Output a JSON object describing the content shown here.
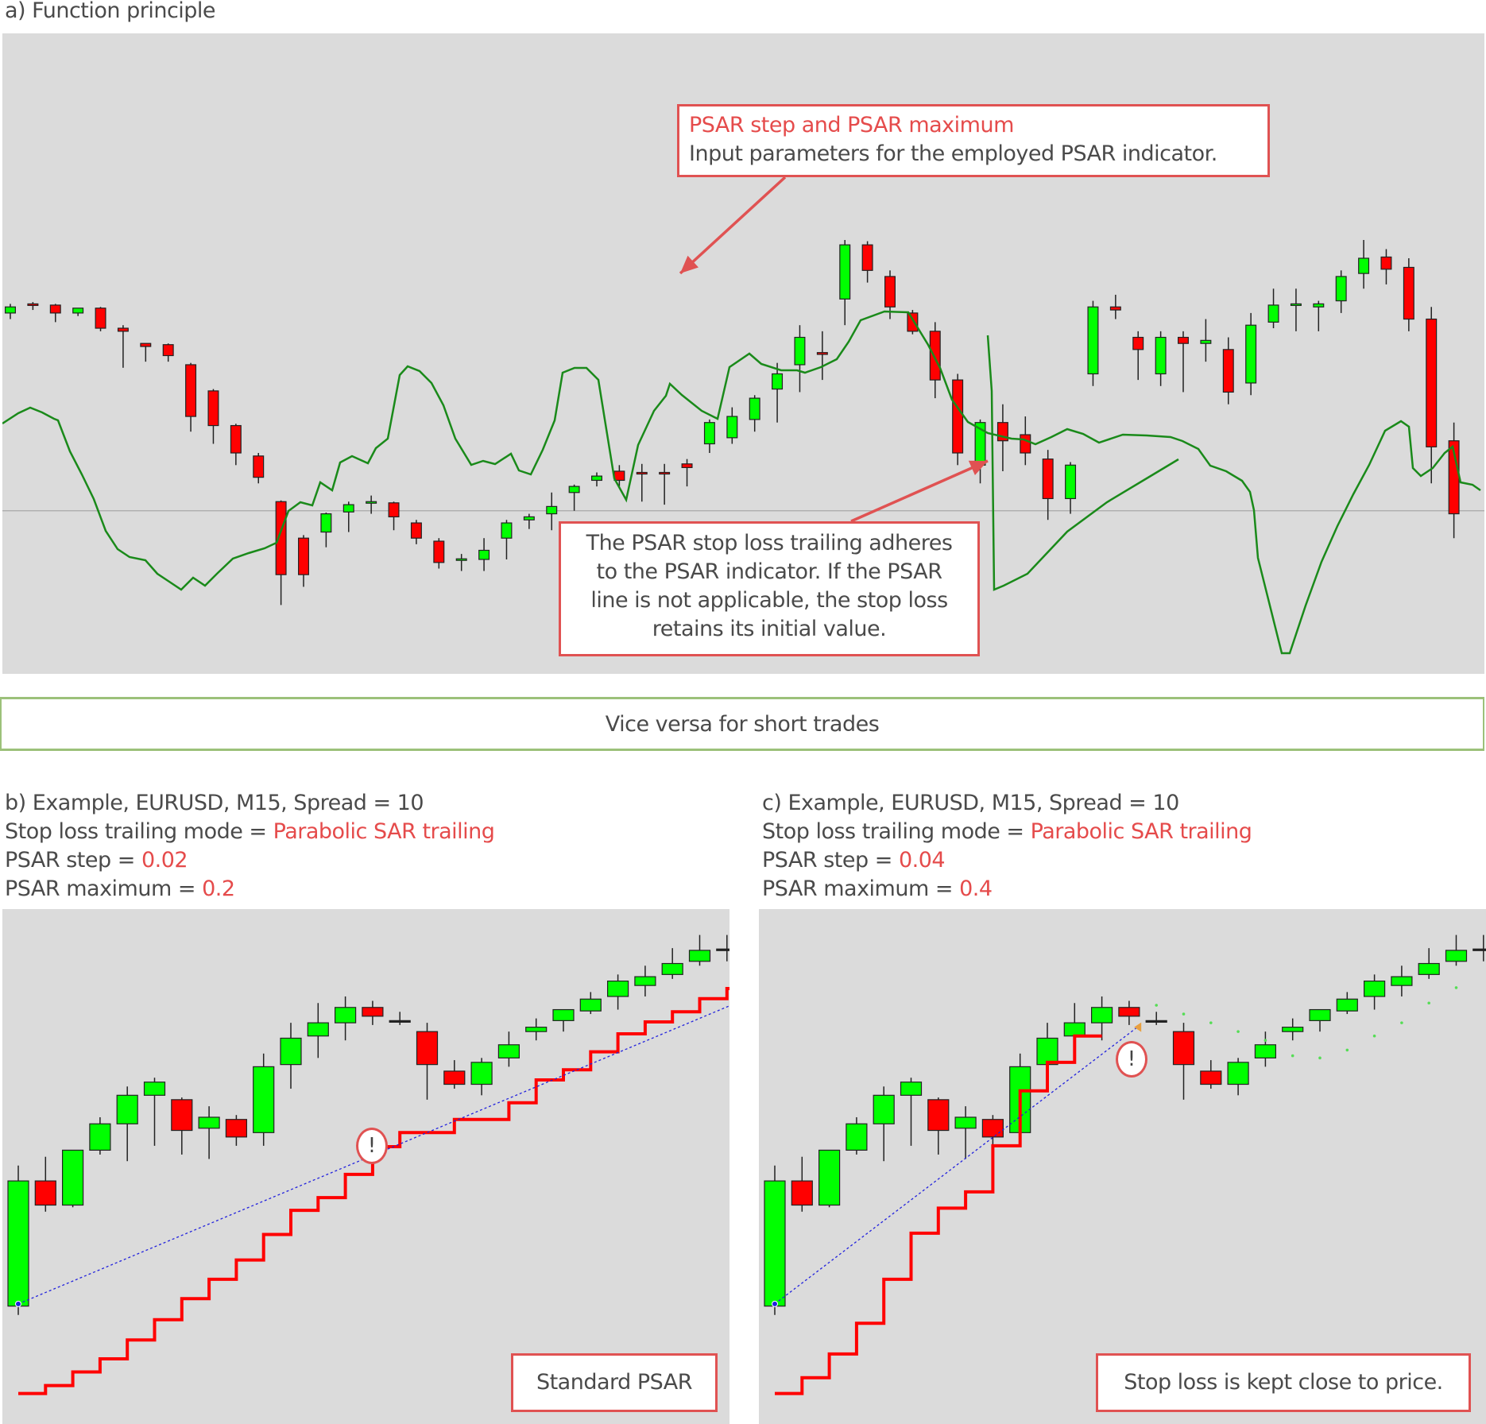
{
  "section_a": {
    "title": "a) Function principle",
    "callout_params": {
      "title": "PSAR step and PSAR maximum",
      "text": "Input parameters for the employed PSAR indicator."
    },
    "callout_behavior": {
      "lines": [
        "The PSAR stop loss trailing adheres",
        "to the PSAR indicator. If the PSAR",
        "line is not applicable, the stop loss",
        "retains its initial value."
      ]
    }
  },
  "vice_versa": "Vice versa for short trades",
  "section_b": {
    "line1": "b) Example, EURUSD, M15, Spread = 10",
    "line2_prefix": "Stop loss trailing mode = ",
    "line2_value": "Parabolic SAR trailing",
    "line3_prefix": "PSAR step = ",
    "line3_value": "0.02",
    "line4_prefix": "PSAR maximum = ",
    "line4_value": "0.2",
    "callout": "Standard PSAR",
    "warning_icon": "!"
  },
  "section_c": {
    "line1": "c) Example, EURUSD, M15, Spread = 10",
    "line2_prefix": "Stop loss trailing mode = ",
    "line2_value": "Parabolic SAR trailing",
    "line3_prefix": "PSAR step = ",
    "line3_value": "0.04",
    "line4_prefix": "PSAR maximum = ",
    "line4_value": "0.4",
    "callout": "Stop loss is kept close to price.",
    "warning_icon": "!"
  },
  "colors": {
    "bull": "#00ff00",
    "bear": "#ff0000",
    "psar_line": "#1a8a1a",
    "stop_loss": "#ff0000",
    "entry_line": "#2222dd",
    "panel_bg": "#dbdbdb",
    "accent": "#e54b4b",
    "green_border": "#9cc17a"
  },
  "chart_data": [
    {
      "type": "candlestick",
      "title": "a) Function principle",
      "note": "relative price units (0 = bottom of chart, 100 = top); no axis ticks shown",
      "ylim": [
        0,
        100
      ],
      "baseline": 25.5,
      "candles": [
        [
          58,
          59,
          57.5,
          59.5,
          57
        ],
        [
          59.5,
          59.3,
          58.7,
          59.8,
          58.5
        ],
        [
          59.3,
          58,
          57.8,
          59.5,
          56.5
        ],
        [
          58,
          58.8,
          57.8,
          58.8,
          57.5
        ],
        [
          58.8,
          55.5,
          55.3,
          59,
          55
        ],
        [
          55.5,
          55,
          50.5,
          56,
          49
        ],
        [
          53,
          52.5,
          52.5,
          53,
          50
        ],
        [
          52.8,
          51,
          50.8,
          53,
          50
        ],
        [
          49.5,
          41,
          41,
          49.8,
          38.5
        ],
        [
          45.2,
          39.5,
          39,
          45.5,
          36.5
        ],
        [
          39.5,
          35,
          34.5,
          39.8,
          33
        ],
        [
          34.5,
          31,
          30.5,
          35,
          30
        ],
        [
          27,
          15,
          12,
          27.2,
          10
        ],
        [
          21,
          15,
          14.5,
          21.5,
          13
        ],
        [
          22,
          25,
          21.8,
          25.2,
          19.5
        ],
        [
          25.3,
          26.5,
          25,
          27,
          22
        ],
        [
          26.8,
          27,
          26.5,
          28,
          25
        ],
        [
          26.8,
          24.5,
          23,
          27,
          22.3
        ],
        [
          23.5,
          21,
          20.5,
          24,
          20
        ],
        [
          20.5,
          17,
          16.5,
          21,
          16
        ],
        [
          17.5,
          17.6,
          15.6,
          18.4,
          15.6
        ],
        [
          17.5,
          19,
          17,
          21,
          15.6
        ],
        [
          21,
          23.5,
          20.5,
          24,
          17.5
        ],
        [
          24,
          24.5,
          23,
          25,
          22.5
        ],
        [
          25,
          26.2,
          24.8,
          28.5,
          22.3
        ],
        [
          28.5,
          29.5,
          28,
          29.8,
          25.5
        ],
        [
          30.5,
          31.2,
          29.8,
          31.8,
          29.5
        ],
        [
          32,
          30.5,
          30.5,
          33,
          29.5
        ],
        [
          31.8,
          31.7,
          31.4,
          33.2,
          27
        ],
        [
          31.8,
          31.7,
          31.4,
          33.2,
          26.5
        ],
        [
          33.2,
          32.6,
          32,
          34,
          29.5
        ],
        [
          36.5,
          40,
          36,
          40.5,
          35
        ],
        [
          37.5,
          41,
          37,
          42.5,
          36.5
        ],
        [
          40.5,
          44,
          40,
          44.5,
          38.5
        ],
        [
          45.5,
          48,
          45,
          49.8,
          40
        ],
        [
          49.5,
          54,
          49,
          56,
          45
        ],
        [
          51.5,
          51.2,
          50.7,
          55,
          47
        ],
        [
          60.3,
          69.2,
          59,
          70,
          56
        ],
        [
          69.2,
          65,
          65,
          69.8,
          63
        ],
        [
          64,
          59,
          58.5,
          65,
          57
        ],
        [
          58,
          55,
          54.5,
          58.5,
          55.2
        ],
        [
          55,
          47,
          46.5,
          56.5,
          44
        ],
        [
          47,
          35,
          35,
          48,
          33
        ],
        [
          33,
          40,
          32.5,
          40.5,
          30
        ],
        [
          40,
          37,
          36.5,
          43,
          32
        ],
        [
          38,
          35,
          34,
          41,
          33
        ],
        [
          34,
          27.5,
          27,
          35.5,
          24
        ],
        [
          27.5,
          33,
          27,
          33.5,
          25
        ],
        [
          48,
          59,
          47,
          60,
          46
        ],
        [
          59,
          58.5,
          57.5,
          61,
          57
        ],
        [
          54,
          52,
          48,
          55,
          47
        ],
        [
          48,
          54,
          47,
          55,
          46
        ],
        [
          54,
          53,
          52.5,
          55,
          45
        ],
        [
          53,
          53.5,
          52,
          57,
          50
        ],
        [
          52,
          45,
          44.5,
          54,
          43
        ],
        [
          46.5,
          56,
          46,
          58,
          44.5
        ],
        [
          56.5,
          59.3,
          56,
          62,
          55.5
        ],
        [
          59.3,
          59.5,
          59,
          62,
          55
        ],
        [
          59,
          59.5,
          58.5,
          60,
          55
        ],
        [
          60,
          64,
          59.5,
          65,
          58
        ],
        [
          64.5,
          67,
          64.2,
          70,
          62
        ],
        [
          67.2,
          65.2,
          64.8,
          68.5,
          62.7
        ],
        [
          65.5,
          57,
          56.5,
          67,
          55
        ],
        [
          57,
          36,
          36,
          59,
          30
        ],
        [
          37,
          25,
          24.5,
          40,
          21
        ]
      ],
      "psar_points_description": "green trailing line above price during downtrends and below price during uptrends; drops to bottom when reversing"
    },
    {
      "type": "candlestick",
      "title": "b) Example, EURUSD, M15, Spread = 10",
      "psar_step": 0.02,
      "psar_maximum": 0.2,
      "ylim": [
        0,
        100
      ],
      "candles": [
        [
          22.5,
          51,
          20.5,
          54.5,
          20.5
        ],
        [
          51,
          45.5,
          45,
          56.5,
          44
        ],
        [
          45.5,
          58,
          45,
          58,
          45.5
        ],
        [
          58,
          64,
          57,
          65.5,
          57.5
        ],
        [
          64,
          70.5,
          63,
          72.5,
          55.5
        ],
        [
          70.5,
          73.5,
          62,
          74.5,
          59
        ],
        [
          69.5,
          62.5,
          62.5,
          70,
          57
        ],
        [
          63,
          65.5,
          61,
          68,
          56
        ],
        [
          65,
          61,
          61,
          66,
          59
        ],
        [
          62,
          77,
          60,
          80,
          59
        ],
        [
          77.5,
          83.5,
          72,
          87,
          72
        ],
        [
          84,
          87,
          79,
          91.5,
          79
        ],
        [
          87,
          90.5,
          87,
          93,
          83
        ],
        [
          90.5,
          88.5,
          86.5,
          92,
          87
        ],
        [
          87.5,
          87.5,
          87,
          89.5,
          86.5
        ],
        [
          85,
          77.5,
          77,
          87,
          69.5
        ],
        [
          76,
          73,
          72.5,
          78.5,
          72
        ],
        [
          73,
          78,
          72.5,
          79,
          70.5
        ],
        [
          79,
          82,
          78,
          85,
          77
        ],
        [
          85,
          86,
          84.5,
          88,
          83
        ],
        [
          87.5,
          90,
          85,
          90,
          86
        ],
        [
          89.7,
          92.4,
          89.5,
          94,
          89
        ],
        [
          93,
          96.5,
          90.5,
          98,
          90
        ],
        [
          95.5,
          97.5,
          94,
          100,
          93
        ],
        [
          98,
          100.5,
          98,
          104,
          97
        ],
        [
          101,
          103.5,
          100.5,
          107,
          100
        ],
        [
          103.8,
          103.8,
          103.5,
          107,
          101
        ],
        [
          103.5,
          99,
          98.5,
          103.5,
          97
        ]
      ],
      "stop_loss_steps": [
        2.6,
        4.4,
        7.5,
        10.5,
        14.8,
        19.4,
        24.2,
        28.6,
        33,
        38.8,
        44.3,
        47.2,
        52.5,
        58.8,
        62,
        62,
        65,
        65,
        68.8,
        74,
        76.3,
        80.4,
        84.5,
        87.2,
        89.5,
        92.5,
        94.8
      ],
      "entry_line_from": [
        0,
        23
      ],
      "entry_line_to": [
        27.3,
        94
      ]
    },
    {
      "type": "candlestick",
      "title": "c) Example, EURUSD, M15, Spread = 10",
      "psar_step": 0.04,
      "psar_maximum": 0.4,
      "ylim": [
        0,
        100
      ],
      "stop_loss_steps": [
        2.6,
        6.2,
        11.6,
        18.6,
        28.6,
        39.1,
        44.8,
        48.5,
        59,
        71.5,
        78,
        84
      ],
      "psar_dots_after_reversal": [
        91,
        89,
        87,
        85,
        83,
        79.5,
        79,
        80.8,
        84,
        87,
        91.5,
        95
      ],
      "entry_line_from": [
        0,
        23
      ],
      "entry_line_to": [
        13.3,
        86
      ]
    }
  ]
}
